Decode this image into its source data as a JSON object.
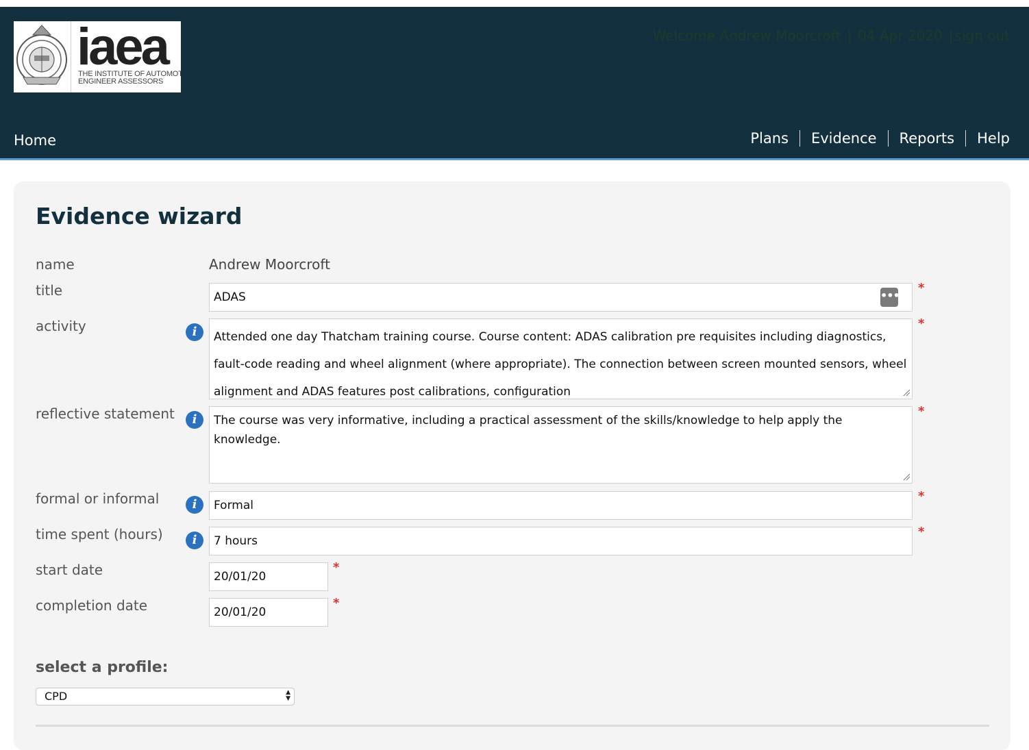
{
  "header": {
    "logo": {
      "word": "iaea",
      "line1": "THE INSTITUTE OF AUTOMOTIVE",
      "line2": "ENGINEER ASSESSORS"
    },
    "welcome": "Welcome Andrew Moorcroft",
    "date": "04 Apr 2020",
    "sign_out": "sign out",
    "nav": {
      "home": "Home",
      "plans": "Plans",
      "evidence": "Evidence",
      "reports": "Reports",
      "help": "Help"
    }
  },
  "page": {
    "title": "Evidence wizard"
  },
  "form": {
    "name": {
      "label": "name",
      "value": "Andrew Moorcroft"
    },
    "title": {
      "label": "title",
      "value": "ADAS"
    },
    "activity": {
      "label": "activity",
      "value": "Attended one day Thatcham training course. Course content: ADAS calibration pre requisites including diagnostics, fault-code reading and wheel alignment (where appropriate). The connection between screen mounted sensors, wheel alignment and ADAS features post calibrations, configuration"
    },
    "reflective": {
      "label": "reflective statement",
      "value": "The course was very informative, including a practical assessment of the skills/knowledge to help apply the knowledge."
    },
    "formal": {
      "label": "formal or informal",
      "value": "Formal"
    },
    "time_spent": {
      "label": "time spent (hours)",
      "value": "7 hours"
    },
    "start_date": {
      "label": "start date",
      "value": "20/01/20"
    },
    "completion_date": {
      "label": "completion date",
      "value": "20/01/20"
    },
    "required_mark": "*",
    "info_glyph": "i",
    "more_glyph": "•••"
  },
  "profile": {
    "heading": "select a profile:",
    "selected": "CPD"
  },
  "colors": {
    "header_bg": "#13303f",
    "panel_bg": "#f4f4f4",
    "info_blue": "#2a72c0",
    "required_red": "#e03030",
    "accent_line": "#5b9fcf"
  }
}
